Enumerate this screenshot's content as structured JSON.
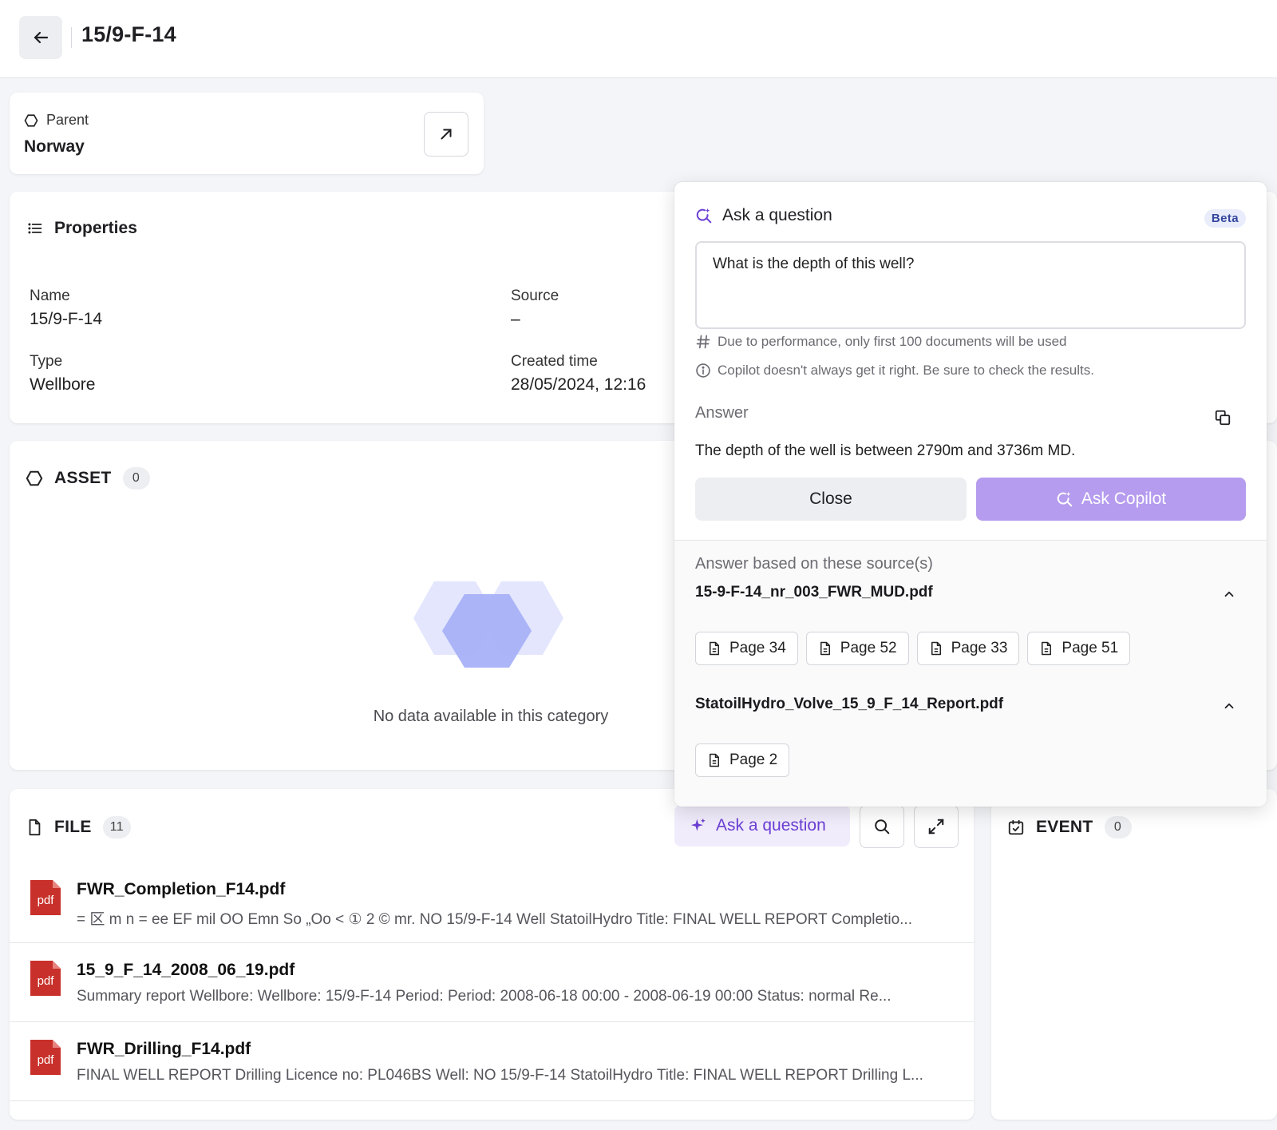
{
  "header": {
    "title": "15/9-F-14"
  },
  "parent": {
    "label": "Parent",
    "value": "Norway"
  },
  "properties": {
    "title": "Properties",
    "fields": [
      {
        "label": "Name",
        "value": "15/9-F-14"
      },
      {
        "label": "Source",
        "value": "–"
      },
      {
        "label": "Type",
        "value": "Wellbore"
      },
      {
        "label": "Created time",
        "value": "28/05/2024, 12:16"
      }
    ]
  },
  "asset": {
    "title": "ASSET",
    "count": "0",
    "empty_text": "No data available in this category"
  },
  "file": {
    "title": "FILE",
    "count": "11",
    "ask_label": "Ask a question",
    "rows": [
      {
        "name": "FWR_Completion_F14.pdf",
        "snippet": "= 区 m n = ee EF mil OO Emn So „Oo < ① 2 © mr. NO 15/9-F-14 Well StatoilHydro Title: FINAL WELL REPORT Completio...",
        "icon_label": "pdf"
      },
      {
        "name": "15_9_F_14_2008_06_19.pdf",
        "snippet": "Summary report Wellbore: Wellbore: 15/9-F-14 Period: Period: 2008-06-18 00:00 - 2008-06-19 00:00 Status: normal Re...",
        "icon_label": "pdf"
      },
      {
        "name": "FWR_Drilling_F14.pdf",
        "snippet": "FINAL WELL REPORT Drilling Licence no: PL046BS Well: NO 15/9-F-14 StatoilHydro Title: FINAL WELL REPORT Drilling L...",
        "icon_label": "pdf"
      }
    ]
  },
  "event": {
    "title": "EVENT",
    "count": "0"
  },
  "copilot": {
    "title": "Ask a question",
    "badge": "Beta",
    "question": "What is the depth of this well?",
    "hint_performance": "Due to performance, only first 100 documents will be used",
    "hint_accuracy": "Copilot doesn't always get it right. Be sure to check the results.",
    "answer_label": "Answer",
    "answer": "The depth of the well is between 2790m and 3736m MD.",
    "close_label": "Close",
    "ask_label": "Ask Copilot",
    "sources_label": "Answer based on these source(s)",
    "sources": [
      {
        "name": "15-9-F-14_nr_003_FWR_MUD.pdf",
        "pages": [
          "Page 34",
          "Page 52",
          "Page 33",
          "Page 51"
        ]
      },
      {
        "name": "StatoilHydro_Volve_15_9_F_14_Report.pdf",
        "pages": [
          "Page 2"
        ]
      }
    ]
  },
  "colors": {
    "accent": "#6b3fd4",
    "copilot_button": "#b69cef",
    "pdf_red": "#c8312b",
    "illustration": "#a6b1f7"
  },
  "icons": [
    "back-arrow-icon",
    "hexagon-icon",
    "external-link-icon",
    "list-icon",
    "document-icon",
    "sparkle-icon",
    "search-icon",
    "expand-icon",
    "calendar-check-icon",
    "copilot-search-icon",
    "hash-icon",
    "info-icon",
    "copy-icon",
    "chevron-up-icon",
    "pdf-icon"
  ]
}
